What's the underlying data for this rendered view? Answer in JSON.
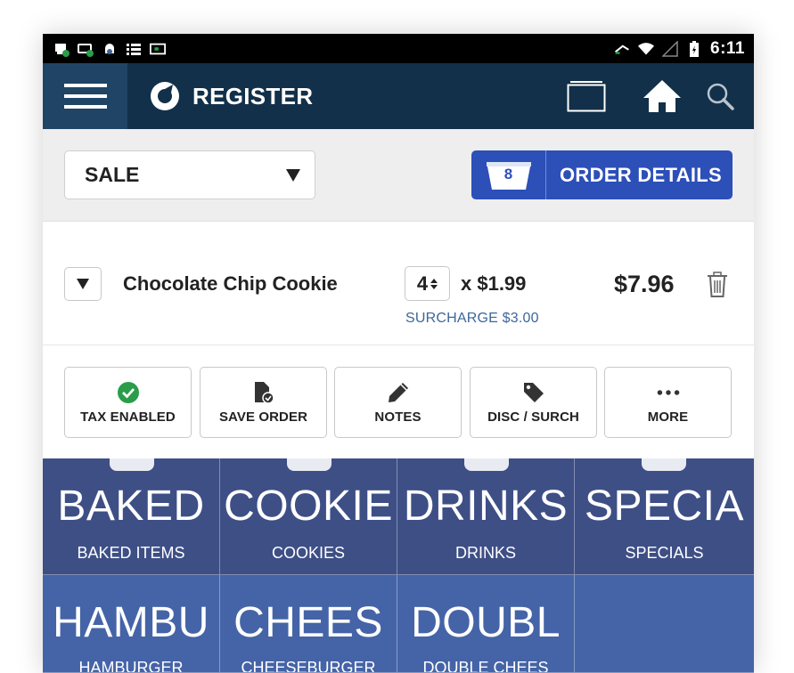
{
  "status_bar": {
    "time": "6:11"
  },
  "header": {
    "title": "REGISTER"
  },
  "toolbar": {
    "sale_select": "SALE",
    "order_count": "8",
    "order_details_label": "ORDER DETAILS"
  },
  "order_line": {
    "item_name": "Chocolate Chip Cookie",
    "quantity": "4",
    "unit_price": "x $1.99",
    "surcharge": "SURCHARGE $3.00",
    "line_total": "$7.96"
  },
  "actions": [
    {
      "label": "TAX ENABLED",
      "icon": "check-circle-icon"
    },
    {
      "label": "SAVE ORDER",
      "icon": "save-document-icon"
    },
    {
      "label": "NOTES",
      "icon": "pencil-icon"
    },
    {
      "label": "DISC / SURCH",
      "icon": "tag-icon"
    },
    {
      "label": "MORE",
      "icon": "more-dots-icon"
    }
  ],
  "categories": [
    {
      "code": "BAKED",
      "name": "BAKED ITEMS"
    },
    {
      "code": "COOKIE",
      "name": "COOKIES"
    },
    {
      "code": "DRINKS",
      "name": "DRINKS"
    },
    {
      "code": "SPECIA",
      "name": "SPECIALS"
    },
    {
      "code": "HAMBU",
      "name": "HAMBURGER"
    },
    {
      "code": "CHEES",
      "name": "CHEESEBURGER"
    },
    {
      "code": "DOUBL",
      "name": "DOUBLE CHEES"
    }
  ],
  "colors": {
    "header_bg": "#123049",
    "menu_bg": "#1f4466",
    "accent": "#2c4fb8",
    "surcharge_text": "#3d6799",
    "tile_row1": "#3e4f86",
    "tile_row2": "#4564a7",
    "check_green": "#2a9d4a"
  }
}
